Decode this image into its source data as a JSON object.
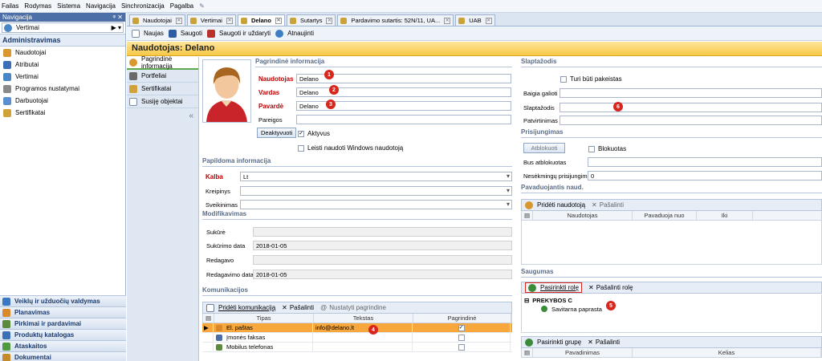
{
  "menu": [
    "Failas",
    "Rodymas",
    "Sistema",
    "Navigacija",
    "Sinchronizacija",
    "Pagalba"
  ],
  "nav": {
    "header": "Navigacija",
    "pin": "ᵠ ✕",
    "selector": "Vertimai",
    "group_title": "Administravimas",
    "items": [
      {
        "label": "Naudotojai",
        "icon": "user-icon",
        "color": "#d9982f"
      },
      {
        "label": "Atributai",
        "icon": "attribute-icon",
        "color": "#3b6fb6"
      },
      {
        "label": "Vertimai",
        "icon": "translation-icon",
        "color": "#4a86c5"
      },
      {
        "label": "Programos nustatymai",
        "icon": "wrench-icon",
        "color": "#8a8a8a"
      },
      {
        "label": "Darbuotojai",
        "icon": "employee-icon",
        "color": "#5c8fd0"
      },
      {
        "label": "Sertifikatai",
        "icon": "certificate-icon",
        "color": "#d2a23a"
      }
    ],
    "bottom_groups": [
      {
        "label": "Veiklų ir užduočių valdymas",
        "icon": "info-icon",
        "color": "#3a78c2"
      },
      {
        "label": "Planavimas",
        "icon": "calendar-icon",
        "color": "#d98a2b"
      },
      {
        "label": "Pirkimai ir pardavimai",
        "icon": "purchase-icon",
        "color": "#5b8a3c"
      },
      {
        "label": "Produktų katalogas",
        "icon": "catalog-icon",
        "color": "#3b6fb6"
      },
      {
        "label": "Ataskaitos",
        "icon": "report-icon",
        "color": "#4f9a3f"
      },
      {
        "label": "Dokumentai",
        "icon": "document-icon",
        "color": "#c48a2b"
      }
    ]
  },
  "tabs": [
    {
      "label": "Naudotojai",
      "icon": "user-icon",
      "active": false
    },
    {
      "label": "Vertimai",
      "icon": "translation-icon",
      "active": false
    },
    {
      "label": "Delano",
      "icon": "user-icon",
      "active": true
    },
    {
      "label": "Sutartys",
      "icon": "contract-icon",
      "active": false
    },
    {
      "label": "Pardavimo sutartis: 52N/11, UA...",
      "icon": "edit-icon",
      "active": false
    },
    {
      "label": "UAB",
      "icon": "company-icon",
      "active": false
    }
  ],
  "toolbar": {
    "new_label": "Naujas",
    "save_label": "Saugoti",
    "save_close_label": "Saugoti ir uždaryti",
    "refresh_label": "Atnaujinti"
  },
  "page_title": "Naudotojas: Delano",
  "left_tabs": [
    "Pagrindinė informacija",
    "Portfeliai",
    "Sertifikatai",
    "Susiję objektai"
  ],
  "collapse_glyph": "«",
  "main_info": {
    "header": "Pagrindinė informacija",
    "username_label": "Naudotojas",
    "username": "Delano",
    "first_name_label": "Vardas",
    "first_name": "Delano",
    "last_name_label": "Pavardė",
    "last_name": "Delano",
    "position_label": "Pareigos",
    "position": "",
    "deactivate_label": "Deaktyvuoti",
    "active_label": "Aktyvus",
    "windows_label": "Leisti naudoti Windows naudotoją"
  },
  "extra_info": {
    "header": "Papildoma informacija",
    "language_label": "Kalba",
    "language": "Lt",
    "address_label": "Kreipinys",
    "address": "",
    "greeting_label": "Sveikinimas",
    "greeting": ""
  },
  "modified": {
    "header": "Modifikavimas",
    "created_by_label": "Sukūrė",
    "created_date_label": "Sukūrimo data",
    "created_date": "2018-01-05",
    "edited_by_label": "Redagavo",
    "edited_date_label": "Redagavimo data",
    "edited_date": "2018-01-05"
  },
  "comms": {
    "header": "Komunikacijos",
    "add_label": "Pridėti komunikaciją",
    "remove_label": "Pašalinti",
    "set_primary_label": "Nustatyti pagrindine",
    "columns": [
      "Tipas",
      "Tekstas",
      "Pagrindinė"
    ],
    "rows": [
      {
        "type": "El. paštas",
        "text": "info@delano.lt",
        "primary": true,
        "icon": "email-icon"
      },
      {
        "type": "Įmonės faksas",
        "text": "",
        "primary": false,
        "icon": "fax-icon"
      },
      {
        "type": "Mobilus telefonas",
        "text": "",
        "primary": false,
        "icon": "phone-icon"
      }
    ]
  },
  "password": {
    "header": "Slaptažodis",
    "must_change_label": "Turi būti pakeistas",
    "valid_until_label": "Baigia galioti",
    "password_label": "Slaptažodis",
    "confirm_label": "Patvirtinimas"
  },
  "logins": {
    "header": "Prisijungimas",
    "unlock_label": "Atblokuoti",
    "blocked_label": "Blokuotas",
    "blocked_until_label": "Bus atblokuotas",
    "failed_label": "Nesėkmingų prisijungimų",
    "failed": "0"
  },
  "substitute": {
    "header": "Pavaduojantis naud.",
    "add_label": "Pridėti naudotoją",
    "remove_label": "Pašalinti",
    "columns": [
      "Naudotojas",
      "Pavaduoja nuo",
      "Iki"
    ]
  },
  "security": {
    "header": "Saugumas",
    "choose_role_label": "Pasirinkti rolę",
    "remove_role_label": "Pašalinti rolę",
    "tree_root": "PREKYBOS C",
    "tree_child": "Savitarna paprasta",
    "choose_group_label": "Pasirinkti grupę",
    "remove_group_label": "Pašalinti",
    "group_columns": [
      "Pavadinimas",
      "Kelias"
    ]
  },
  "badges": [
    "1",
    "2",
    "3",
    "4",
    "5",
    "6"
  ],
  "colors": {
    "accent": "#f7c948",
    "badge": "#d8261c",
    "required": "#c00000",
    "selected_row": "#f7a73b"
  }
}
